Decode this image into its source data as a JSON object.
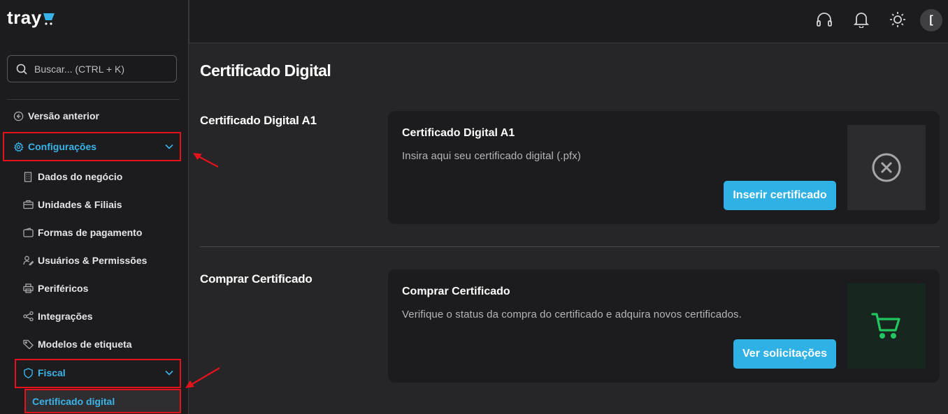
{
  "logo": {
    "text": "tray"
  },
  "search": {
    "placeholder": "Buscar... (CTRL + K)"
  },
  "sidebar": {
    "back": "Versão anterior",
    "settings": "Configurações",
    "items": [
      {
        "label": "Dados do negócio",
        "icon": "building-icon"
      },
      {
        "label": "Unidades & Filiais",
        "icon": "briefcase-icon"
      },
      {
        "label": "Formas de pagamento",
        "icon": "wallet-icon"
      },
      {
        "label": "Usuários & Permissões",
        "icon": "user-edit-icon"
      },
      {
        "label": "Periféricos",
        "icon": "printer-icon"
      },
      {
        "label": "Integrações",
        "icon": "share-icon"
      },
      {
        "label": "Modelos de etiqueta",
        "icon": "tag-icon"
      }
    ],
    "fiscal": "Fiscal",
    "current": "Certificado digital"
  },
  "topbar": {
    "avatar": "["
  },
  "main": {
    "title": "Certificado Digital",
    "sections": [
      {
        "label": "Certificado Digital A1",
        "card_title": "Certificado Digital A1",
        "card_desc": "Insira aqui seu certificado digital (.pfx)",
        "button": "Inserir certificado"
      },
      {
        "label": "Comprar Certificado",
        "card_title": "Comprar Certificado",
        "card_desc": "Verifique o status da compra do certificado e adquira novos certificados.",
        "button": "Ver solicitações"
      }
    ]
  },
  "colors": {
    "accent": "#2fb1e6",
    "active_text": "#39b4e8",
    "highlight_box": "#e5121c",
    "cart_green": "#22c55e",
    "sidebar_bg": "#1c1c1e",
    "main_bg": "#262628"
  }
}
